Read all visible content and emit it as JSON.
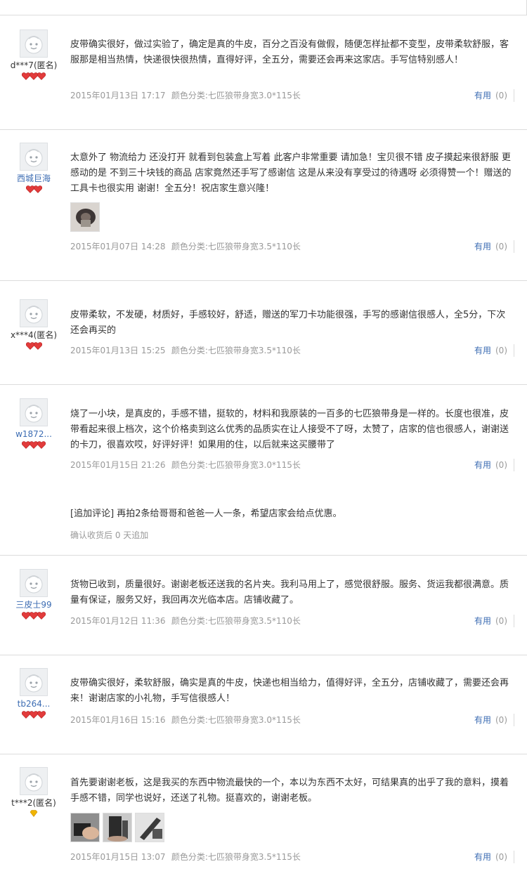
{
  "reviews": [
    {
      "user": "d***7(匿名)",
      "user_is_link": false,
      "level": "red",
      "level_count": 3,
      "text": "皮带确实很好，做过实验了，确定是真的牛皮，百分之百没有做假，随便怎样扯都不变型，皮带柔软舒服，客服那是相当热情，快递很快很热情，直得好评，全五分，需要还会再来这家店。手写信特别感人！",
      "date": "2015年01月13日 17:17",
      "sku": "颜色分类:七匹狼带身宽3.0*115长",
      "useful_label": "有用",
      "useful_count": "(0)"
    },
    {
      "user": "西城巨海",
      "user_is_link": true,
      "level": "red",
      "level_count": 2,
      "text": "太意外了 物流给力 还没打开 就看到包装盒上写着 此客户非常重要 请加急！宝贝很不错 皮子摸起来很舒服 更感动的是 不到三十块钱的商品 店家竟然还手写了感谢信 这是从来没有享受过的待遇呀 必须得赞一个！赠送的工具卡也很实用 谢谢！全五分！祝店家生意兴隆！",
      "date": "2015年01月07日 14:28",
      "sku": "颜色分类:七匹狼带身宽3.5*110长",
      "useful_label": "有用",
      "useful_count": "(0)",
      "photos": [
        "belt-photo"
      ]
    },
    {
      "user": "x***4(匿名)",
      "user_is_link": false,
      "level": "red",
      "level_count": 2,
      "text": "皮带柔软，不发硬，材质好，手感较好，舒适，赠送的军刀卡功能很强，手写的感谢信很感人，全5分，下次还会再买的",
      "date": "2015年01月13日 15:25",
      "sku": "颜色分类:七匹狼带身宽3.5*110长",
      "useful_label": "有用",
      "useful_count": "(0)"
    },
    {
      "user": "w1872...",
      "user_is_link": true,
      "level": "red",
      "level_count": 3,
      "text": "烧了一小块，是真皮的，手感不错，挺软的，材料和我原装的一百多的七匹狼带身是一样的。长度也很准，皮带看起来很上档次，这个价格卖到这么优秀的品质实在让人接受不了呀，太赞了，店家的信也很感人，谢谢送的卡刀，很喜欢哎，好评好评！如果用的住，以后就来这买腰带了",
      "date": "2015年01月15日 21:26",
      "sku": "颜色分类:七匹狼带身宽3.0*115长",
      "useful_label": "有用",
      "useful_count": "(0)",
      "append_text": "[追加评论] 再拍2条给哥哥和爸爸一人一条，希望店家会给点优惠。",
      "append_meta": "确认收货后 0 天追加"
    },
    {
      "user": "三皮士99",
      "user_is_link": true,
      "level": "red",
      "level_count": 3,
      "text": "货物已收到，质量很好。谢谢老板还送我的名片夹。我利马用上了，感觉很舒服。服务、货运我都很满意。质量有保证，服务又好，我回再次光临本店。店铺收藏了。",
      "date": "2015年01月12日 11:36",
      "sku": "颜色分类:七匹狼带身宽3.5*110长",
      "useful_label": "有用",
      "useful_count": "(0)"
    },
    {
      "user": "tb264...",
      "user_is_link": true,
      "level": "red",
      "level_count": 3,
      "text": "皮带确实很好，柔软舒服，确实是真的牛皮，快递也相当给力，值得好评，全五分，店铺收藏了，需要还会再来！谢谢店家的小礼物，手写信很感人！",
      "date": "2015年01月16日 15:16",
      "sku": "颜色分类:七匹狼带身宽3.0*115长",
      "useful_label": "有用",
      "useful_count": "(0)"
    },
    {
      "user": "t***2(匿名)",
      "user_is_link": false,
      "level": "gold",
      "level_count": 1,
      "text": "首先要谢谢老板，这是我买的东西中物流最快的一个，本以为东西不太好，可结果真的出乎了我的意料，摸着手感不错，同学也说好，还送了礼物。挺喜欢的，谢谢老板。",
      "date": "2015年01月15日 13:07",
      "sku": "颜色分类:七匹狼带身宽3.5*115长",
      "useful_label": "有用",
      "useful_count": "(0)",
      "photos": [
        "hand-photo",
        "box-photo",
        "knife-photo"
      ]
    }
  ],
  "colors": {
    "link": "#3d6db3",
    "meta": "#999999",
    "text": "#333333",
    "divider": "#dcdcdc",
    "heart_red": "#e23b3b",
    "diamond_gold": "#f0b400"
  }
}
